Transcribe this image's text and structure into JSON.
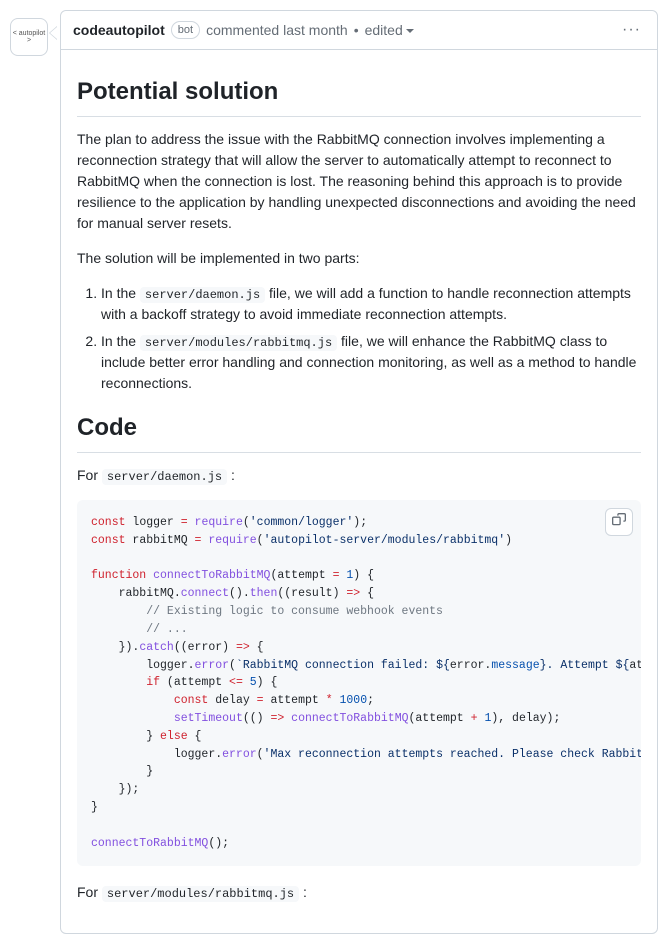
{
  "author": "codeautopilot",
  "bot_badge": "bot",
  "commented": "commented last month",
  "edited": "edited",
  "avatar_text": "< autopilot >",
  "headings": {
    "solution": "Potential solution",
    "code": "Code"
  },
  "paras": {
    "p1": "The plan to address the issue with the RabbitMQ connection involves implementing a reconnection strategy that will allow the server to automatically attempt to reconnect to RabbitMQ when the connection is lost. The reasoning behind this approach is to provide resilience to the application by handling unexpected disconnections and avoiding the need for manual server resets.",
    "p2": "The solution will be implemented in two parts:"
  },
  "list": {
    "li1a": "In the ",
    "li1code": "server/daemon.js",
    "li1b": " file, we will add a function to handle reconnection attempts with a backoff strategy to avoid immediate reconnection attempts.",
    "li2a": "In the ",
    "li2code": "server/modules/rabbitmq.js",
    "li2b": " file, we will enhance the RabbitMQ class to include better error handling and connection monitoring, as well as a method to handle reconnections."
  },
  "for1a": "For ",
  "for1code": "server/daemon.js",
  "for1b": " :",
  "for2a": "For ",
  "for2code": "server/modules/rabbitmq.js",
  "for2b": " :",
  "code1": {
    "l1": {
      "kw1": "const",
      "name": " logger ",
      "eq": "= ",
      "fn": "require",
      "op": "(",
      "str": "'common/logger'",
      "cl": ");"
    },
    "l2": {
      "kw1": "const",
      "name": " rabbitMQ ",
      "eq": "= ",
      "fn": "require",
      "op": "(",
      "str": "'autopilot-server/modules/rabbitmq'",
      "cl": ")"
    },
    "l3": "",
    "l4": {
      "kw": "function",
      "fn": " connectToRabbitMQ",
      "sig1": "(",
      "arg": "attempt",
      "sig2": " = ",
      "num": "1",
      "sig3": ") {"
    },
    "l5": {
      "ind": "    rabbitMQ.",
      "m1": "connect",
      "p1": "().",
      "m2": "then",
      "p2": "((",
      "arg": "result",
      "p3": ") ",
      "arr": "=>",
      "p4": " {"
    },
    "l6": "        // Existing logic to consume webhook events",
    "l7": "        // ...",
    "l8": {
      "ind": "    }).",
      "m": "catch",
      "p1": "((",
      "arg": "error",
      "p2": ") ",
      "arr": "=>",
      "p3": " {"
    },
    "l9": {
      "ind": "        logger.",
      "m": "error",
      "p1": "(",
      "str1": "`RabbitMQ connection failed: ",
      "tpl1": "${",
      "e1": "error",
      "dot": ".",
      "prop": "message",
      "tpl1e": "}",
      "str2": ". Attempt ",
      "tpl2": "${",
      "e2": "attempt",
      "tpl2e": "}",
      "str3": "`",
      "p2": ");"
    },
    "l10": {
      "ind": "        ",
      "kw": "if",
      "p1": " (attempt ",
      "op": "<=",
      "sp": " ",
      "num": "5",
      "p2": ") {"
    },
    "l11": {
      "ind": "            ",
      "kw": "const",
      "name": " delay ",
      "eq": "= ",
      "expr": "attempt ",
      "op": "*",
      "sp": " ",
      "num": "1000",
      "end": ";"
    },
    "l12": {
      "ind": "            ",
      "fn": "setTimeout",
      "p1": "(() ",
      "arr": "=>",
      "sp": " ",
      "call": "connectToRabbitMQ",
      "p2": "(attempt ",
      "op": "+",
      "sp2": " ",
      "num": "1",
      "p3": "), delay);"
    },
    "l13": {
      "ind": "        } ",
      "kw": "else",
      "p": " {"
    },
    "l14": {
      "ind": "            logger.",
      "m": "error",
      "p1": "(",
      "str": "'Max reconnection attempts reached. Please check RabbitMQ server.'",
      "p2": ");"
    },
    "l15": "        }",
    "l16": "    });",
    "l17": "}",
    "l18": "",
    "l19": {
      "fn": "connectToRabbitMQ",
      "p": "();"
    }
  }
}
